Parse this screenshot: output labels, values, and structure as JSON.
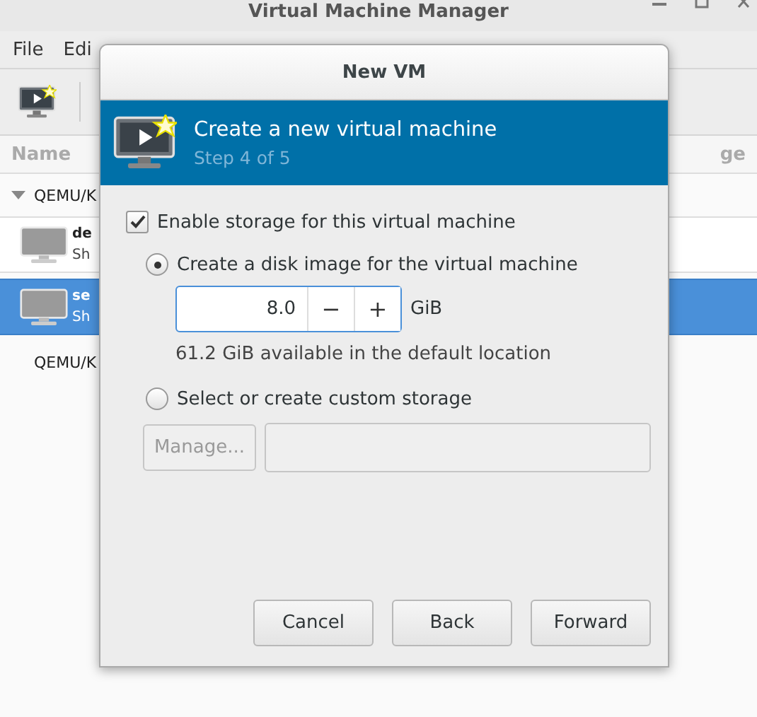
{
  "main_window": {
    "title": "Virtual Machine Manager",
    "menu": [
      "File",
      "Edi"
    ],
    "columns": [
      "Name",
      "ge"
    ],
    "connections": [
      {
        "name": "QEMU/K",
        "expanded": true,
        "vms": [
          {
            "name": "de",
            "status": "Sh",
            "selected": false
          },
          {
            "name": "se",
            "status": "Sh",
            "selected": true
          }
        ]
      },
      {
        "name": "QEMU/K",
        "expanded": false
      }
    ]
  },
  "dialog": {
    "title": "New VM",
    "header": {
      "title": "Create a new virtual machine",
      "step": "Step 4 of 5"
    },
    "enable_storage": {
      "label": "Enable storage for this virtual machine",
      "checked": true
    },
    "options": [
      {
        "label": "Create a disk image for the virtual machine",
        "selected": true
      },
      {
        "label": "Select or create custom storage",
        "selected": false
      }
    ],
    "disk_size": {
      "value": "8.0",
      "decrement": "−",
      "increment": "+",
      "unit": "GiB"
    },
    "available": "61.2 GiB available in the default location",
    "manage_button": {
      "label": "Manage...",
      "disabled": true
    },
    "buttons": [
      "Cancel",
      "Back",
      "Forward"
    ]
  }
}
